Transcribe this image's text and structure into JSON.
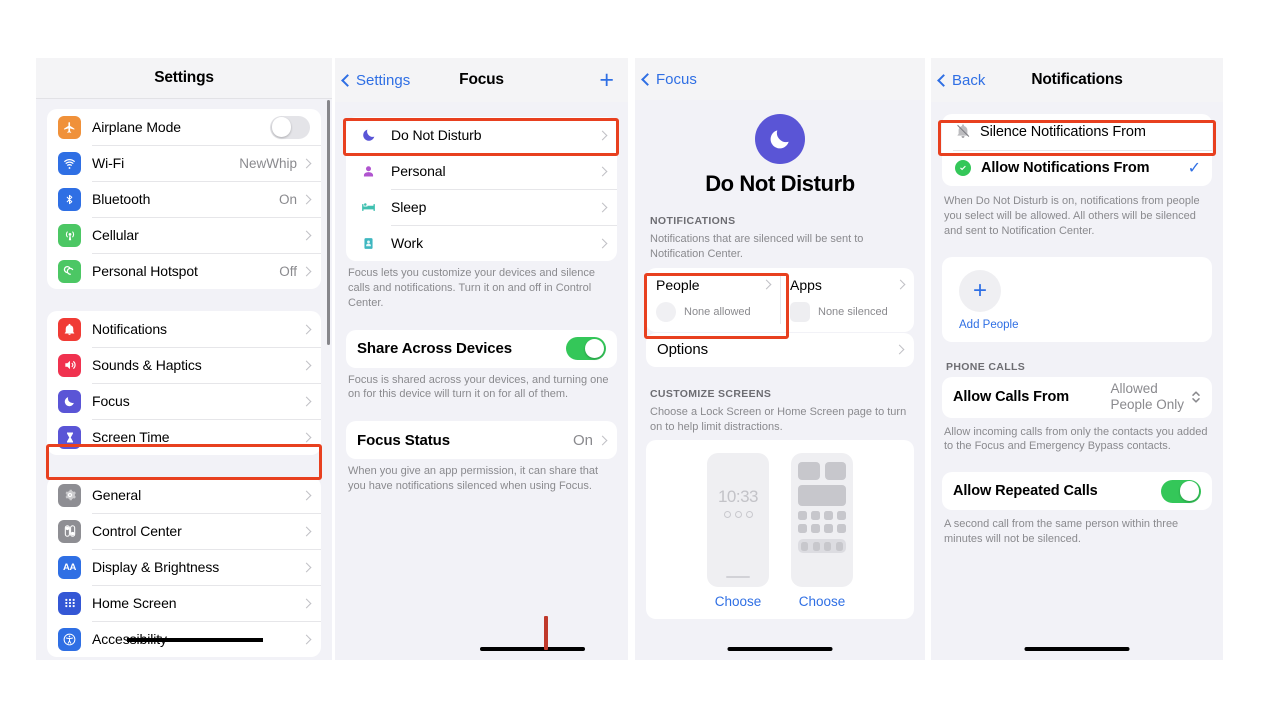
{
  "panel1": {
    "nav": {
      "title": "Settings"
    },
    "group1": [
      {
        "label": "Airplane Mode",
        "icon": "airplane-icon",
        "icon_color": "#f0913a",
        "glyph": "✈",
        "control": "toggle",
        "on": false
      },
      {
        "label": "Wi-Fi",
        "icon": "wifi-icon",
        "icon_color": "#2f6fe4",
        "glyph": "◠",
        "value": "NewWhip",
        "control": "chevron"
      },
      {
        "label": "Bluetooth",
        "icon": "bluetooth-icon",
        "icon_color": "#2f6fe4",
        "glyph": "ᛦ",
        "value": "On",
        "control": "chevron"
      },
      {
        "label": "Cellular",
        "icon": "cellular-icon",
        "icon_color": "#4cc764",
        "glyph": "\u0001",
        "value": "",
        "control": "chevron"
      },
      {
        "label": "Personal Hotspot",
        "icon": "hotspot-icon",
        "icon_color": "#4cc764",
        "glyph": "\u0001",
        "value": "Off",
        "control": "chevron"
      }
    ],
    "group2": [
      {
        "label": "Notifications",
        "icon": "notifications-icon",
        "icon_color": "#f03b35",
        "glyph": "\u0001",
        "control": "chevron"
      },
      {
        "label": "Sounds & Haptics",
        "icon": "sounds-icon",
        "icon_color": "#f0324f",
        "glyph": "\u0001",
        "control": "chevron"
      },
      {
        "label": "Focus",
        "icon": "focus-moon-icon",
        "icon_color": "#5a55d6",
        "glyph": "☾",
        "control": "chevron",
        "highlighted": true
      },
      {
        "label": "Screen Time",
        "icon": "screen-time-icon",
        "icon_color": "#5a55d6",
        "glyph": "⧗",
        "control": "chevron"
      }
    ],
    "group3": [
      {
        "label": "General",
        "icon": "gear-icon",
        "icon_color": "#8e8e93",
        "glyph": "⚙",
        "control": "chevron"
      },
      {
        "label": "Control Center",
        "icon": "control-center-icon",
        "icon_color": "#8e8e93",
        "glyph": "\u0001",
        "control": "chevron"
      },
      {
        "label": "Display & Brightness",
        "icon": "display-icon",
        "icon_color": "#2f6fe4",
        "glyph": "AA",
        "control": "chevron"
      },
      {
        "label": "Home Screen",
        "icon": "home-screen-icon",
        "icon_color": "#3457d5",
        "glyph": "⌸",
        "control": "chevron"
      },
      {
        "label": "Accessibility",
        "icon": "accessibility-icon",
        "icon_color": "#2f6fe4",
        "glyph": "\u0001",
        "control": "chevron"
      }
    ]
  },
  "panel2": {
    "nav": {
      "back": "Settings",
      "title": "Focus",
      "add": "+"
    },
    "modes": [
      {
        "label": "Do Not Disturb",
        "icon": "moon-icon",
        "color": "#5a55d6",
        "glyph": "☾",
        "highlighted": true
      },
      {
        "label": "Personal",
        "icon": "person-icon",
        "color": "#b054cf",
        "glyph": "\u0001"
      },
      {
        "label": "Sleep",
        "icon": "bed-icon",
        "color": "#3fc0b0",
        "glyph": "\u0001"
      },
      {
        "label": "Work",
        "icon": "work-badge-icon",
        "color": "#3fb7c0",
        "glyph": "\u0001"
      }
    ],
    "modes_footer": "Focus lets you customize your devices and silence calls and notifications. Turn it on and off in Control Center.",
    "share": {
      "label": "Share Across Devices",
      "on": true
    },
    "share_footer": "Focus is shared across your devices, and turning one on for this device will turn it on for all of them.",
    "status": {
      "label": "Focus Status",
      "value": "On"
    },
    "status_footer": "When you give an app permission, it can share that you have notifications silenced when using Focus."
  },
  "panel3": {
    "nav": {
      "back": "Focus"
    },
    "hero": {
      "title": "Do Not Disturb",
      "icon": "moon-icon",
      "color": "#5a55d6",
      "glyph": "☾"
    },
    "notifications_header": "NOTIFICATIONS",
    "notifications_sub": "Notifications that are silenced will be sent to Notification Center.",
    "people": {
      "title": "People",
      "sub": "None allowed",
      "highlighted": true
    },
    "apps": {
      "title": "Apps",
      "sub": "None silenced"
    },
    "options": {
      "label": "Options"
    },
    "customize_header": "CUSTOMIZE SCREENS",
    "customize_sub": "Choose a Lock Screen or Home Screen page to turn on to help limit distractions.",
    "lock_time": "10:33",
    "choose_lock": "Choose",
    "choose_home": "Choose"
  },
  "panel4": {
    "nav": {
      "back": "Back",
      "title": "Notifications"
    },
    "silence": {
      "label": "Silence Notifications From",
      "icon": "bell-slash-icon",
      "highlighted": true
    },
    "allow": {
      "label": "Allow Notifications From",
      "icon": "check-badge-icon",
      "selected": true,
      "check": "✓"
    },
    "allow_footer": "When Do Not Disturb is on, notifications from people you select will be allowed. All others will be silenced and sent to Notification Center.",
    "add_people": {
      "label": "Add People",
      "plus": "+"
    },
    "phone_calls_header": "PHONE CALLS",
    "allow_calls": {
      "label": "Allow Calls From",
      "value_line1": "Allowed",
      "value_line2": "People Only"
    },
    "allow_calls_footer": "Allow incoming calls from only the contacts you added to the Focus and Emergency Bypass contacts.",
    "repeated": {
      "label": "Allow Repeated Calls",
      "on": true
    },
    "repeated_footer": "A second call from the same person within three minutes will not be silenced."
  },
  "colors": {
    "highlight": "#e8401f",
    "accent": "#2f6fe4",
    "green": "#34c759"
  }
}
